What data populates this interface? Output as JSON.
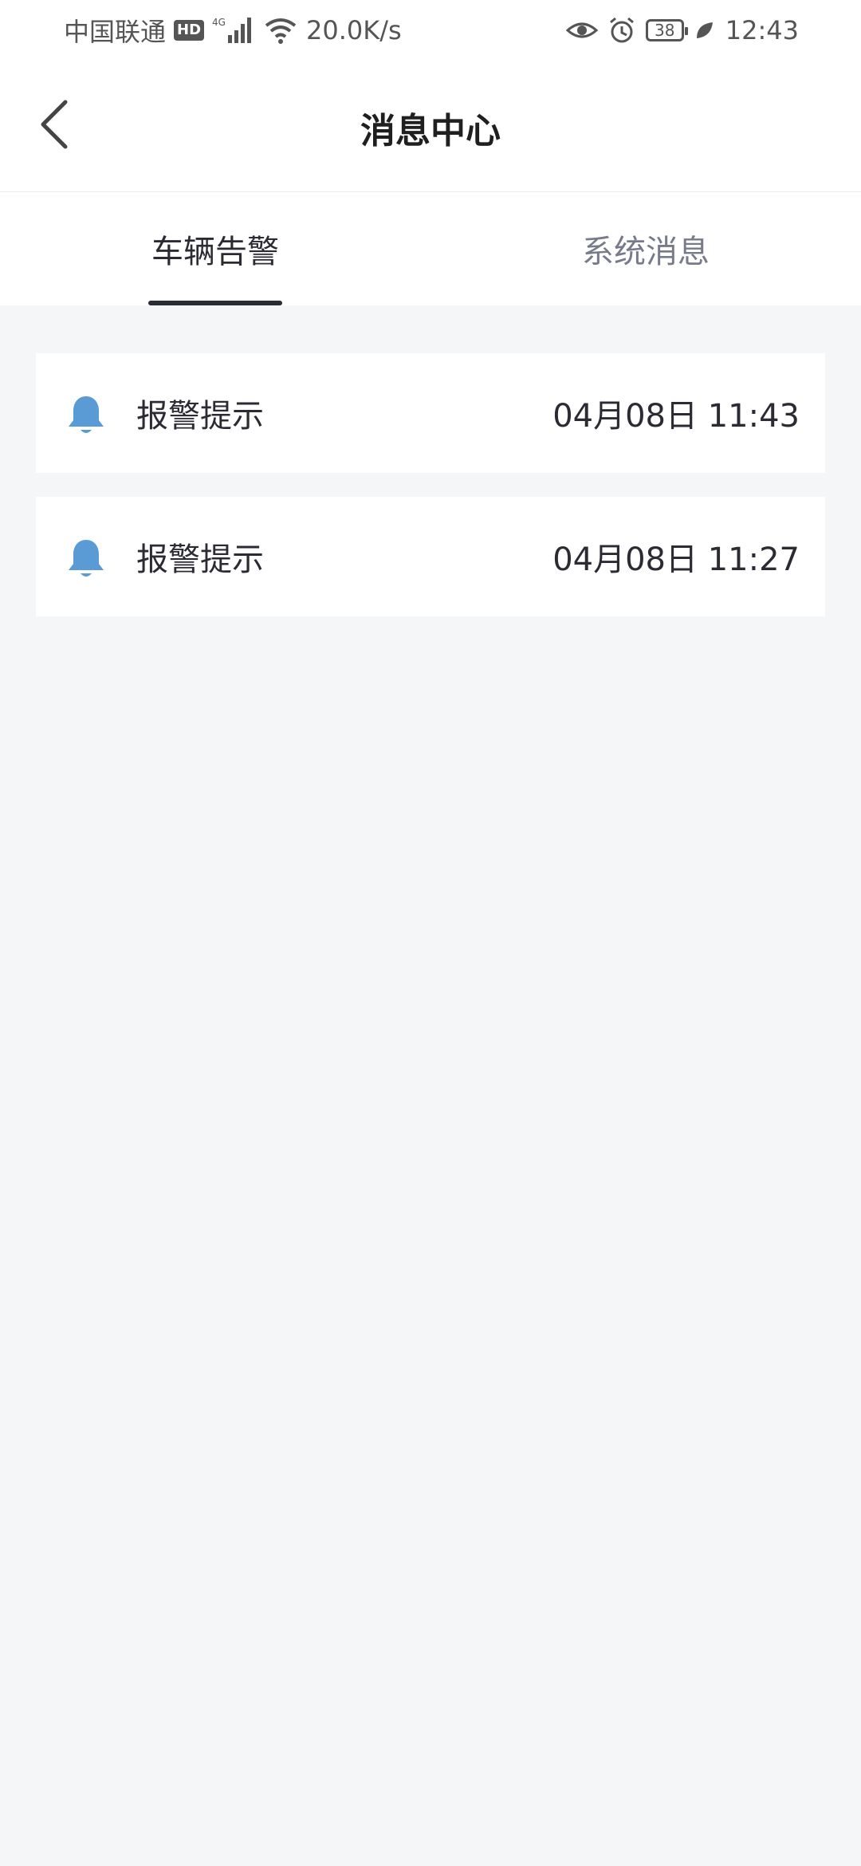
{
  "status_bar": {
    "carrier": "中国联通",
    "hd": "HD",
    "network": "4G",
    "speed": "20.0K/s",
    "battery": "38",
    "time": "12:43"
  },
  "header": {
    "title": "消息中心"
  },
  "tabs": [
    {
      "label": "车辆告警",
      "active": true
    },
    {
      "label": "系统消息",
      "active": false
    }
  ],
  "messages": [
    {
      "title": "报警提示",
      "time": "04月08日 11:43",
      "icon": "bell-icon"
    },
    {
      "title": "报警提示",
      "time": "04月08日 11:27",
      "icon": "bell-icon"
    }
  ],
  "colors": {
    "accent": "#5b9bd5",
    "background": "#f5f6f8",
    "tab_active": "#2b2b33",
    "tab_inactive": "#777a8a"
  }
}
